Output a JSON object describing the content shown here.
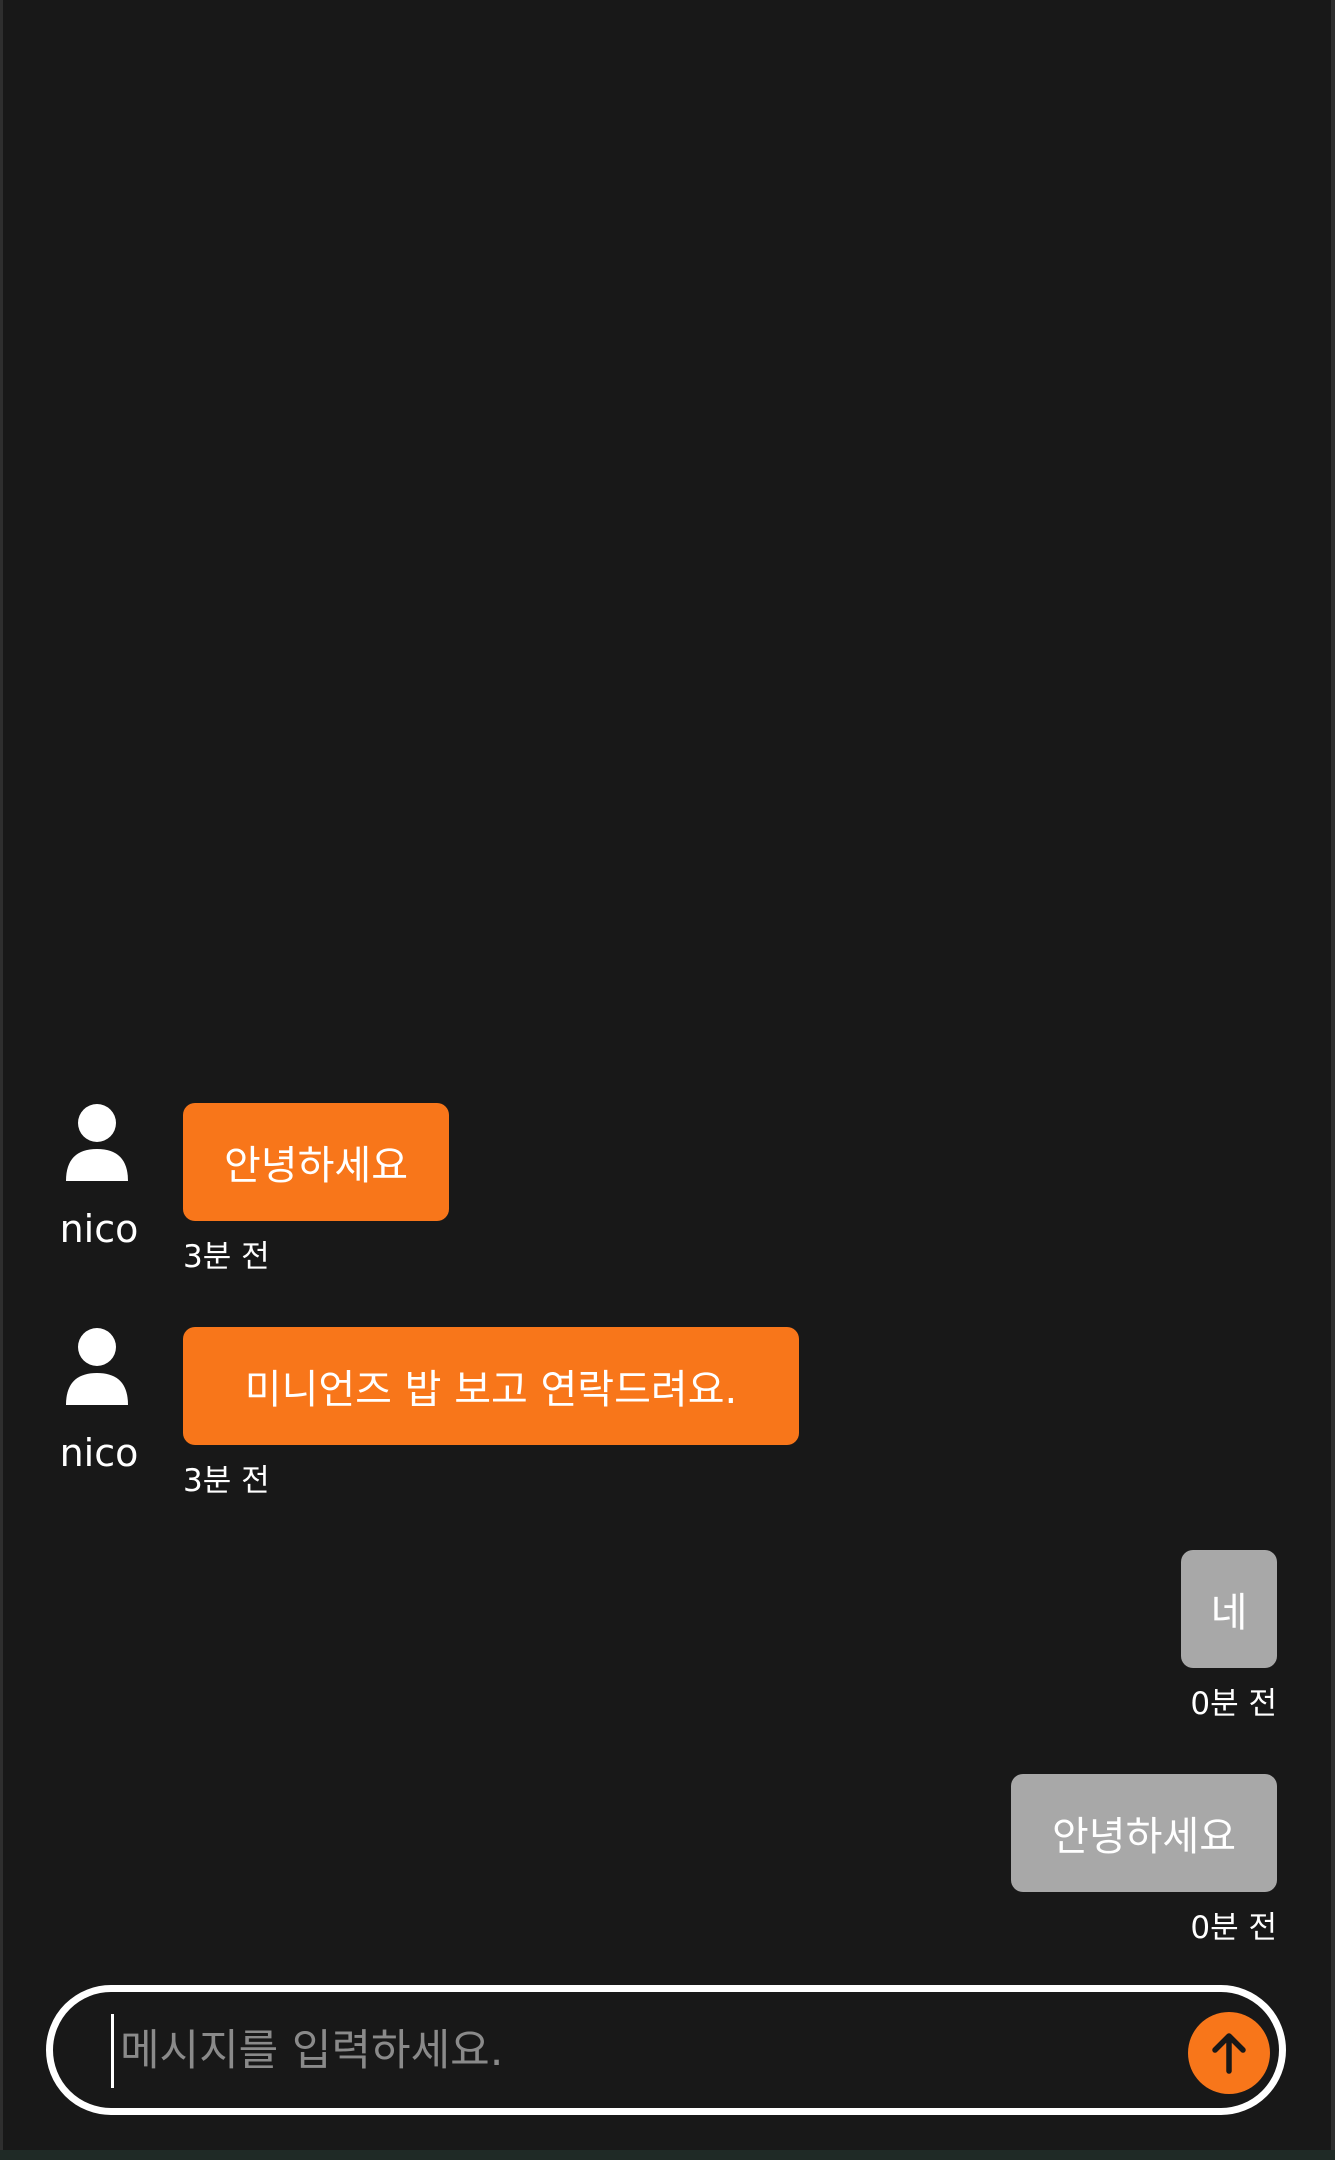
{
  "messages": [
    {
      "sender": "nico",
      "text": "안녕하세요",
      "time": "3분 전",
      "mine": false
    },
    {
      "sender": "nico",
      "text": "미니언즈 밥 보고 연락드려요.",
      "time": "3분 전",
      "mine": false
    },
    {
      "sender": "",
      "text": "네",
      "time": "0분 전",
      "mine": true
    },
    {
      "sender": "",
      "text": "안녕하세요",
      "time": "0분 전",
      "mine": true
    }
  ],
  "composer": {
    "placeholder": "메시지를 입력하세요.",
    "value": "",
    "send_icon": "arrow-up-icon"
  },
  "colors": {
    "background": "#181818",
    "incoming_bubble": "#f8761a",
    "outgoing_bubble": "#a8a8a8",
    "send_button": "#f8761a",
    "text": "#ffffff"
  },
  "icons": {
    "avatar": "user-icon",
    "send": "arrow-up-icon"
  }
}
